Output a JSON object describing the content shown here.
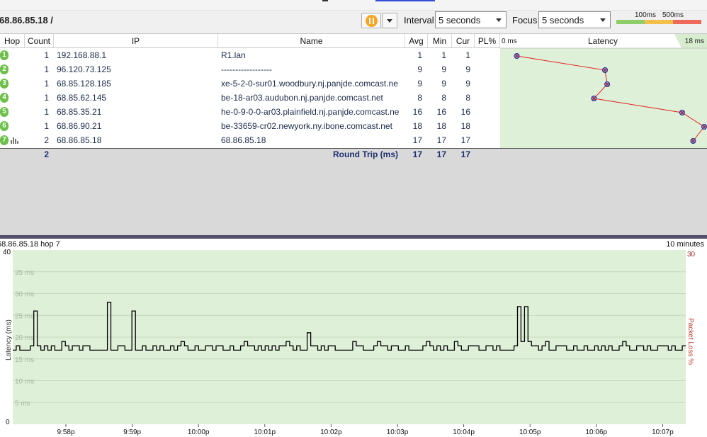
{
  "target": {
    "label": "68.86.85.18 /"
  },
  "toolbar": {
    "interval_label": "Interval",
    "interval_value": "5 seconds",
    "focus_label": "Focus",
    "focus_value": "5 seconds",
    "scale_100": "100ms",
    "scale_500": "500ms",
    "scale_colors": [
      "#8fcc6a",
      "#f5c04a",
      "#ee6a5a"
    ]
  },
  "table": {
    "columns": [
      "Hop",
      "Count",
      "IP",
      "Name",
      "Avg",
      "Min",
      "Cur",
      "PL%"
    ],
    "latency_header": {
      "left": "0 ms",
      "title": "Latency",
      "right": "18 ms"
    },
    "rows": [
      {
        "hop": "1",
        "count": "1",
        "ip": "192.168.88.1",
        "name": "R1.lan",
        "avg": "1",
        "min": "1",
        "cur": "1",
        "latency_ms": 1
      },
      {
        "hop": "2",
        "count": "1",
        "ip": "96.120.73.125",
        "name": "------------------",
        "avg": "9",
        "min": "9",
        "cur": "9",
        "latency_ms": 9
      },
      {
        "hop": "3",
        "count": "1",
        "ip": "68.85.128.185",
        "name": "xe-5-2-0-sur01.woodbury.nj.panjde.comcast.ne",
        "avg": "9",
        "min": "9",
        "cur": "9",
        "latency_ms": 9.2
      },
      {
        "hop": "4",
        "count": "1",
        "ip": "68.85.62.145",
        "name": "be-18-ar03.audubon.nj.panjde.comcast.net",
        "avg": "8",
        "min": "8",
        "cur": "8",
        "latency_ms": 8
      },
      {
        "hop": "5",
        "count": "1",
        "ip": "68.85.35.21",
        "name": "he-0-9-0-0-ar03.plainfield.nj.panjde.comcast.ne",
        "avg": "16",
        "min": "16",
        "cur": "16",
        "latency_ms": 16
      },
      {
        "hop": "6",
        "count": "1",
        "ip": "68.86.90.21",
        "name": "be-33659-cr02.newyork.ny.ibone.comcast.net",
        "avg": "18",
        "min": "18",
        "cur": "18",
        "latency_ms": 18
      },
      {
        "hop": "7",
        "count": "2",
        "ip": "68.86.85.18",
        "name": "68.86.85.18",
        "avg": "17",
        "min": "17",
        "cur": "17",
        "latency_ms": 17
      }
    ],
    "round_trip": {
      "count": "2",
      "label": "Round Trip (ms)",
      "avg": "17",
      "min": "17",
      "cur": "17"
    }
  },
  "graph": {
    "title": "68.86.85.18 hop 7",
    "range": "10 minutes",
    "y_label": "Latency (ms)",
    "y2_label": "Packet Loss %",
    "y_max_label": "40",
    "y_min_label": "0",
    "y2_max_label": "30",
    "gridlines": [
      "35 ms",
      "30 ms",
      "25 ms",
      "20 ms",
      "15 ms",
      "10 ms",
      "5 ms"
    ],
    "x_ticks": [
      "9:58p",
      "9:59p",
      "10:00p",
      "10:01p",
      "10:02p",
      "10:03p",
      "10:04p",
      "10:05p",
      "10:06p",
      "10:07p"
    ],
    "bg_color": "#dff0d8",
    "line_color": "#000000"
  },
  "chart_data": {
    "type": "line",
    "xlabel": "",
    "ylabel": "Latency (ms)",
    "ylim": [
      0,
      40
    ],
    "x_tick_labels": [
      "9:58p",
      "9:59p",
      "10:00p",
      "10:01p",
      "10:02p",
      "10:03p",
      "10:04p",
      "10:05p",
      "10:06p",
      "10:07p"
    ],
    "series": [
      {
        "values": [
          17,
          18,
          17,
          17,
          17,
          18,
          26,
          18,
          17,
          18,
          17,
          18,
          17,
          17,
          19,
          18,
          17,
          18,
          18,
          17,
          18,
          18,
          17,
          17,
          17,
          17,
          17,
          28,
          17,
          17,
          18,
          18,
          17,
          17,
          26,
          17,
          17,
          18,
          17,
          17,
          18,
          17,
          18,
          17,
          17,
          18,
          17,
          18,
          19,
          18,
          17,
          17,
          18,
          17,
          17,
          18,
          18,
          17,
          18,
          18,
          17,
          17,
          18,
          17,
          17,
          18,
          19,
          18,
          18,
          17,
          18,
          17,
          18,
          17,
          18,
          17,
          18,
          18,
          19,
          18,
          17,
          18,
          17,
          17,
          21,
          18,
          18,
          17,
          18,
          17,
          18,
          18,
          17,
          17,
          17,
          17,
          17,
          19,
          18,
          18,
          17,
          17,
          17,
          18,
          19,
          18,
          18,
          17,
          18,
          18,
          17,
          17,
          18,
          17,
          17,
          17,
          17,
          18,
          19,
          18,
          17,
          18,
          17,
          18,
          17,
          17,
          19,
          18,
          17,
          17,
          18,
          18,
          18,
          17,
          17,
          18,
          18,
          17,
          18,
          17,
          17,
          17,
          17,
          18,
          27,
          19,
          27,
          19,
          18,
          18,
          17,
          18,
          19,
          17,
          17,
          18,
          18,
          18,
          17,
          17,
          18,
          17,
          17,
          18,
          17,
          17,
          18,
          17,
          18,
          17,
          18,
          17,
          17,
          18,
          19,
          18,
          17,
          17,
          18,
          18,
          17,
          18,
          17,
          17,
          18,
          18,
          18,
          17,
          18,
          17,
          17,
          18
        ]
      }
    ]
  }
}
